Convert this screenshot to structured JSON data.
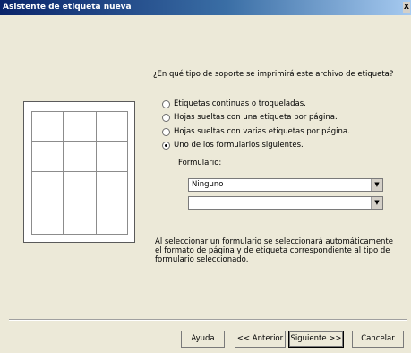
{
  "window": {
    "title": "Asistente de etiqueta nueva",
    "close_label": "X"
  },
  "main": {
    "question": "¿En qué tipo de soporte se imprimirá este archivo de etiqueta?",
    "options": [
      {
        "label": "Etiquetas continuas o troqueladas.",
        "selected": false
      },
      {
        "label": "Hojas sueltas con una etiqueta por página.",
        "selected": false
      },
      {
        "label": "Hojas sueltas con varias etiquetas por página.",
        "selected": false
      },
      {
        "label": "Uno de los formularios siguientes.",
        "selected": true
      }
    ],
    "form_label": "Formulario:",
    "form_select_value": "Ninguno",
    "second_select_value": "",
    "note": "Al seleccionar un formulario se seleccionará automáticamente el formato de página y de etiqueta correspondiente al tipo de formulario seleccionado."
  },
  "preview": {
    "rows": 4,
    "columns": 3
  },
  "buttons": {
    "help": "Ayuda",
    "back": "<< Anterior",
    "next": "Siguiente >>",
    "cancel": "Cancelar"
  }
}
